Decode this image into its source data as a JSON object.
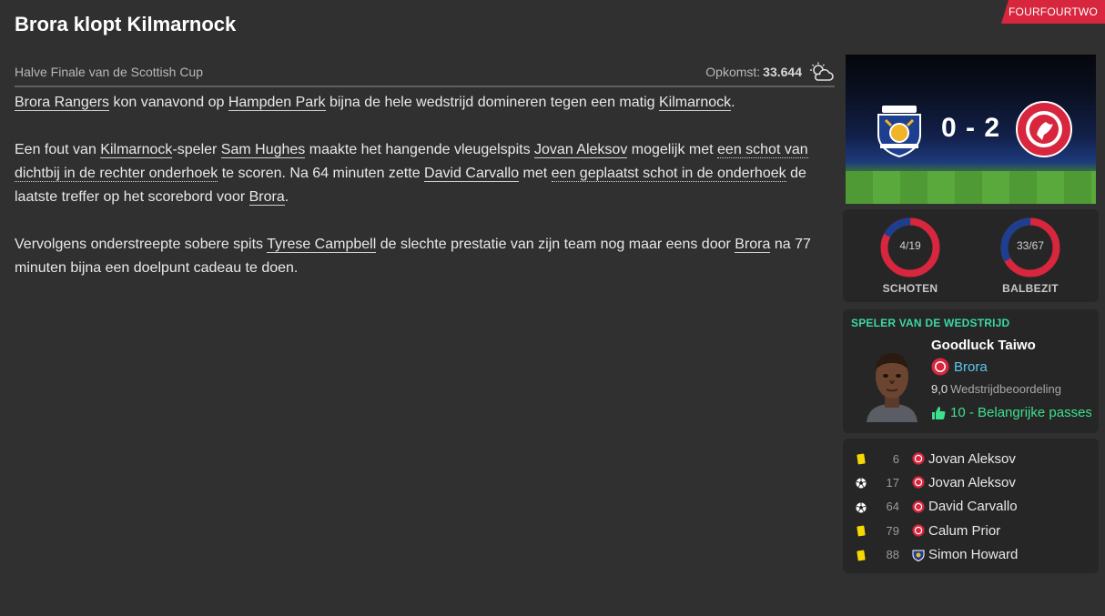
{
  "brand_tag": "FOURFOURTWO",
  "title": "Brora klopt Kilmarnock",
  "competition": "Halve Finale van de Scottish Cup",
  "attendance": {
    "label": "Opkomst:",
    "value": "33.644",
    "weather_icon": "partly-cloudy-icon"
  },
  "article": {
    "p1": {
      "a": "Brora Rangers",
      "b": " kon vanavond op ",
      "c": "Hampden Park",
      "d": " bijna de hele wedstrijd domineren tegen een matig ",
      "e": "Kilmarnock",
      "f": "."
    },
    "p2": {
      "a": "Een fout van ",
      "b": "Kilmarnock",
      "c": "-speler ",
      "d": "Sam Hughes",
      "e": " maakte het hangende vleugelspits ",
      "f": "Jovan Aleksov",
      "g": " mogelijk met ",
      "h": "een schot van dichtbij in de rechter onderhoek",
      "i": " te scoren. Na 64 minuten zette ",
      "j": "David Carvallo",
      "k": " met ",
      "l": "een geplaatst schot in de onderhoek",
      "m": " de laatste treffer op het scorebord voor ",
      "n": "Brora",
      "o": "."
    },
    "p3": {
      "a": "Vervolgens onderstreepte sobere spits ",
      "b": "Tyrese Campbell",
      "c": " de slechte prestatie van zijn team nog maar eens door ",
      "d": "Brora",
      "e": " na 77 minuten bijna een doelpunt cadeau te doen."
    }
  },
  "score": {
    "home": "0",
    "away": "2",
    "text": "0 - 2",
    "home_color": "#1e3f8f",
    "away_color": "#d7263d"
  },
  "stats": [
    {
      "label": "SCHOTEN",
      "value_text": "4/19",
      "home": 4,
      "away": 19
    },
    {
      "label": "BALBEZIT",
      "value_text": "33/67",
      "home": 33,
      "away": 67
    }
  ],
  "motm": {
    "heading": "SPELER VAN DE WEDSTRIJD",
    "name": "Goodluck Taiwo",
    "club": "Brora",
    "rating": "9,0",
    "rating_label": "Wedstrijdbeoordeling",
    "highlight": "10 - Belangrijke passes",
    "highlight_icon": "thumbs-up-icon"
  },
  "events": [
    {
      "icon": "yellow-card-icon",
      "minute": "6",
      "team": "away",
      "player": "Jovan Aleksov"
    },
    {
      "icon": "goal-ball-icon",
      "minute": "17",
      "team": "away",
      "player": "Jovan Aleksov"
    },
    {
      "icon": "goal-ball-icon",
      "minute": "64",
      "team": "away",
      "player": "David Carvallo"
    },
    {
      "icon": "yellow-card-icon",
      "minute": "79",
      "team": "away",
      "player": "Calum Prior"
    },
    {
      "icon": "yellow-card-icon",
      "minute": "88",
      "team": "home",
      "player": "Simon Howard"
    }
  ],
  "colors": {
    "accent_red": "#d7263d",
    "home_blue": "#1e3f8f",
    "motm_teal": "#3cd6a6",
    "link_blue": "#5cc8ee",
    "highlight_green": "#3ce08c",
    "yellow_card": "#f5d800"
  }
}
